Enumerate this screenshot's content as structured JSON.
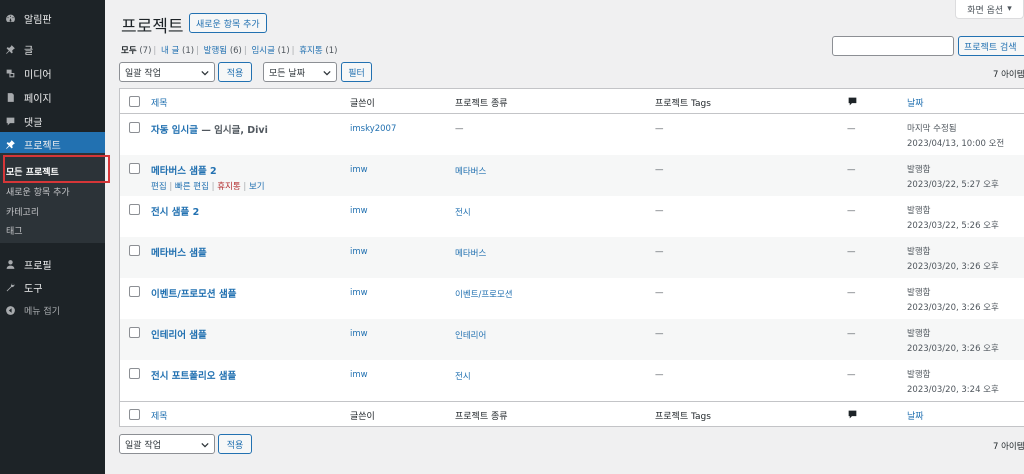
{
  "sidebar": {
    "items": [
      {
        "label": "알림판",
        "icon": "dashboard-icon"
      },
      {
        "label": "글",
        "icon": "pin-icon"
      },
      {
        "label": "미디어",
        "icon": "media-icon"
      },
      {
        "label": "페이지",
        "icon": "page-icon"
      },
      {
        "label": "댓글",
        "icon": "comment-icon"
      },
      {
        "label": "프로젝트",
        "icon": "pin-icon"
      },
      {
        "label": "프로필",
        "icon": "user-icon"
      },
      {
        "label": "도구",
        "icon": "wrench-icon"
      },
      {
        "label": "메뉴 접기",
        "icon": "collapse-icon"
      }
    ],
    "submenu": [
      "모든 프로젝트",
      "새로운 항목 추가",
      "카테고리",
      "태그"
    ]
  },
  "header": {
    "title": "프로젝트",
    "add_new": "새로운 항목 추가",
    "screen_options": "화면 옵션"
  },
  "views": [
    {
      "label": "모두",
      "count": "(7)"
    },
    {
      "label": "내 글",
      "count": "(1)"
    },
    {
      "label": "발행됨",
      "count": "(6)"
    },
    {
      "label": "임시글",
      "count": "(1)"
    },
    {
      "label": "휴지통",
      "count": "(1)"
    }
  ],
  "search": {
    "placeholder": "",
    "button": "프로젝트 검색"
  },
  "bulk": {
    "label": "일괄 작업",
    "apply": "적용"
  },
  "date_filter": {
    "label": "모든 날짜",
    "button": "필터"
  },
  "items_count": "7 아이템",
  "columns": {
    "title": "제목",
    "author": "글쓴이",
    "type": "프로젝트 종류",
    "tags": "프로젝트 Tags",
    "date": "날짜"
  },
  "rows": [
    {
      "title": "자동 임시글",
      "state": " — 임시글, Divi",
      "author": "imsky2007",
      "type": "—",
      "tags": "—",
      "comments": "—",
      "status": "마지막 수정됨",
      "date": "2023/04/13, 10:00 오전"
    },
    {
      "title": "메타버스 샘플 2",
      "state": "",
      "author": "imw",
      "type": "메타버스",
      "tags": "—",
      "comments": "—",
      "status": "발행함",
      "date": "2023/03/22, 5:27 오후"
    },
    {
      "title": "전시 샘플 2",
      "state": "",
      "author": "imw",
      "type": "전시",
      "tags": "—",
      "comments": "—",
      "status": "발행함",
      "date": "2023/03/22, 5:26 오후"
    },
    {
      "title": "메타버스 샘플",
      "state": "",
      "author": "imw",
      "type": "메타버스",
      "tags": "—",
      "comments": "—",
      "status": "발행함",
      "date": "2023/03/20, 3:26 오후"
    },
    {
      "title": "이벤트/프로모션 샘플",
      "state": "",
      "author": "imw",
      "type": "이벤트/프로모션",
      "tags": "—",
      "comments": "—",
      "status": "발행함",
      "date": "2023/03/20, 3:26 오후"
    },
    {
      "title": "인테리어 샘플",
      "state": "",
      "author": "imw",
      "type": "인테리어",
      "tags": "—",
      "comments": "—",
      "status": "발행함",
      "date": "2023/03/20, 3:26 오후"
    },
    {
      "title": "전시 포트폴리오 샘플",
      "state": "",
      "author": "imw",
      "type": "전시",
      "tags": "—",
      "comments": "—",
      "status": "발행함",
      "date": "2023/03/20, 3:24 오후"
    }
  ],
  "row_actions": {
    "edit": "편집",
    "quick_edit": "빠른 편집",
    "trash": "휴지통",
    "view": "보기",
    "sep": " | "
  }
}
